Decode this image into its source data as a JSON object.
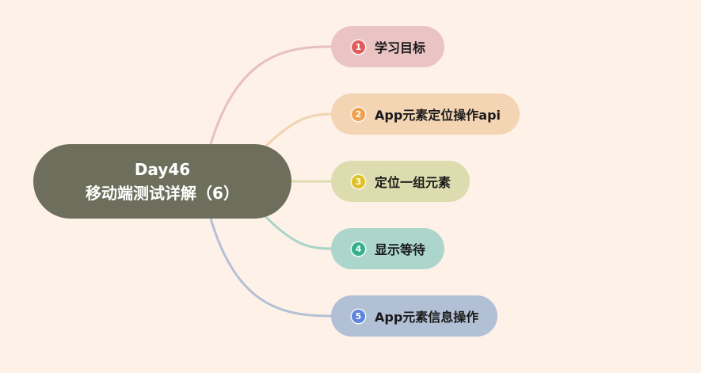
{
  "root": {
    "line1": "Day46",
    "line2": "移动端测试详解（6）",
    "color": "#6d6f5c"
  },
  "branches": [
    {
      "badge": "1",
      "label": "学习目标",
      "fill": "#e9c4c2",
      "line": "#e7c0bd",
      "badge_color": "#e25b5b"
    },
    {
      "badge": "2",
      "label": "App元素定位操作api",
      "fill": "#f3d4b3",
      "line": "#f2d3b1",
      "badge_color": "#f0a14f"
    },
    {
      "badge": "3",
      "label": "定位一组元素",
      "fill": "#dcdcaf",
      "line": "#dcdcaf",
      "badge_color": "#e0c023"
    },
    {
      "badge": "4",
      "label": "显示等待",
      "fill": "#acd6cc",
      "line": "#a9d4c8",
      "badge_color": "#33b08a"
    },
    {
      "badge": "5",
      "label": "App元素信息操作",
      "fill": "#b2c0d5",
      "line": "#b4c0d4",
      "badge_color": "#5c84df"
    }
  ]
}
